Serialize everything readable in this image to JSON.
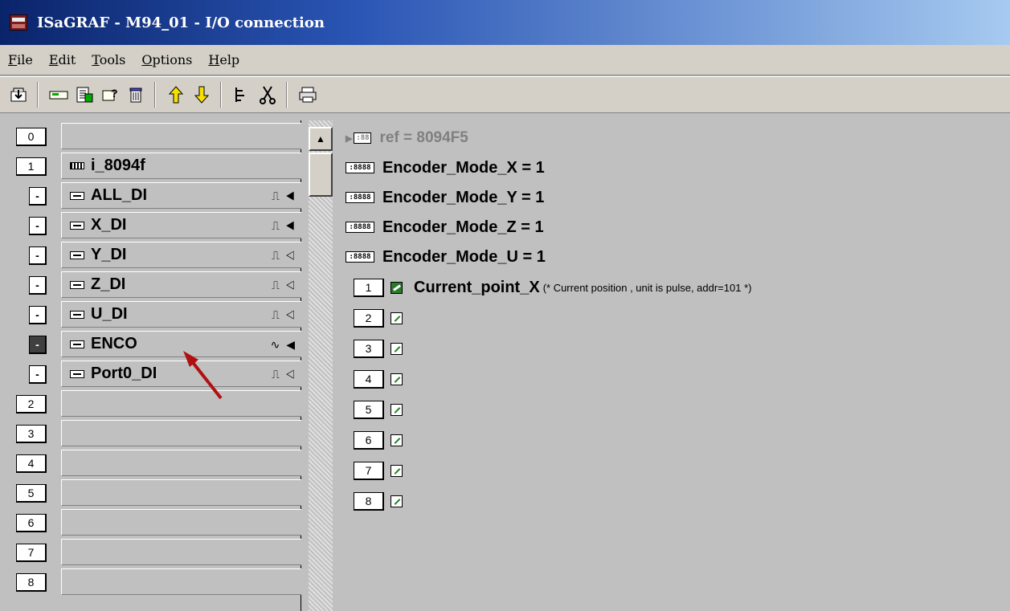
{
  "window": {
    "title": "ISaGRAF - M94_01 - I/O connection"
  },
  "menu": {
    "items": [
      {
        "first": "F",
        "rest": "ile"
      },
      {
        "first": "E",
        "rest": "dit"
      },
      {
        "first": "T",
        "rest": "ools"
      },
      {
        "first": "O",
        "rest": "ptions"
      },
      {
        "first": "H",
        "rest": "elp"
      }
    ]
  },
  "toolbar": {
    "groups": [
      [
        "open-icon"
      ],
      [
        "board-icon",
        "list-icon",
        "properties-icon",
        "delete-icon"
      ],
      [
        "move-up-icon",
        "move-down-icon"
      ],
      [
        "tree-icon",
        "cut-icon"
      ],
      [
        "print-icon"
      ]
    ]
  },
  "slots": {
    "rows": [
      {
        "num": "0",
        "label": ""
      },
      {
        "num": "1",
        "label": "i_8094f"
      },
      {
        "toggle": "-",
        "label": "ALL_DI",
        "marks": "⎍ ◀"
      },
      {
        "toggle": "-",
        "label": "X_DI",
        "marks": "⎍ ◀"
      },
      {
        "toggle": "-",
        "label": "Y_DI",
        "marks": "⎍ ◁"
      },
      {
        "toggle": "-",
        "label": "Z_DI",
        "marks": "⎍ ◁"
      },
      {
        "toggle": "-",
        "label": "U_DI",
        "marks": "⎍ ◁"
      },
      {
        "toggle": "-",
        "label": "ENCO",
        "marks": "∿ ◀",
        "active": true
      },
      {
        "toggle": "-",
        "label": "Port0_DI",
        "marks": "⎍ ◁"
      },
      {
        "num": "2",
        "label": ""
      },
      {
        "num": "3",
        "label": ""
      },
      {
        "num": "4",
        "label": ""
      },
      {
        "num": "5",
        "label": ""
      },
      {
        "num": "6",
        "label": ""
      },
      {
        "num": "7",
        "label": ""
      },
      {
        "num": "8",
        "label": ""
      }
    ]
  },
  "params": [
    {
      "text": "ref = 8094F5",
      "dim": true
    },
    {
      "text": "Encoder_Mode_X = 1"
    },
    {
      "text": "Encoder_Mode_Y = 1"
    },
    {
      "text": "Encoder_Mode_Z = 1"
    },
    {
      "text": "Encoder_Mode_U = 1"
    }
  ],
  "channels": [
    {
      "num": "1",
      "var": "Current_point_X",
      "comment": "(* Current position , unit is pulse, addr=101 *)"
    },
    {
      "num": "2"
    },
    {
      "num": "3"
    },
    {
      "num": "4"
    },
    {
      "num": "5"
    },
    {
      "num": "6"
    },
    {
      "num": "7"
    },
    {
      "num": "8"
    }
  ],
  "colors": {
    "title_start": "#0a246a",
    "title_end": "#a6caf0",
    "arrow": "#b01010",
    "var_icon": "#2a7a2a"
  }
}
